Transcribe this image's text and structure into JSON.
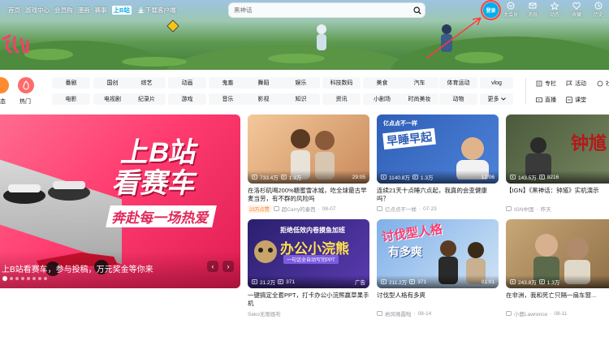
{
  "header": {
    "nav": [
      "首页",
      "游戏中心",
      "会员购",
      "漫画",
      "赛事"
    ],
    "tv": "上B站",
    "download": "下载客户端",
    "search_placeholder": "黑神话",
    "login": "登录",
    "right_icons": [
      {
        "icon": "vip-icon",
        "label": "大会员"
      },
      {
        "icon": "message-icon",
        "label": "消息"
      },
      {
        "icon": "dynamic-icon",
        "label": "动态"
      },
      {
        "icon": "favorite-icon",
        "label": "收藏"
      },
      {
        "icon": "history-icon",
        "label": "历史"
      }
    ]
  },
  "categories": {
    "big": [
      {
        "icon": "trending-icon",
        "label": "热门"
      },
      {
        "icon": "dynamic-icon",
        "label": "态"
      }
    ],
    "row1": [
      "番剧",
      "国创",
      "综艺",
      "动画",
      "鬼畜",
      "舞蹈",
      "娱乐",
      "科技数码",
      "美食",
      "汽车",
      "体育运动",
      "vlog"
    ],
    "row2": [
      "电影",
      "电视剧",
      "纪录片",
      "游戏",
      "音乐",
      "影视",
      "知识",
      "资讯",
      "小剧场",
      "时尚美妆",
      "动物",
      "更多"
    ],
    "links": [
      {
        "icon": "column-icon",
        "label": "专栏"
      },
      {
        "icon": "activity-icon",
        "label": "活动"
      },
      {
        "icon": "live-icon",
        "label": "直播"
      },
      {
        "icon": "course-icon",
        "label": "课堂"
      },
      {
        "icon": "community-icon",
        "label": "社"
      }
    ]
  },
  "hero": {
    "line1": "上B站",
    "line2": "看赛车",
    "slogan": "奔赴每一场热爱",
    "caption": "上B站看赛车，参与投稿，万元奖金等你来",
    "prev": "‹",
    "next": "›"
  },
  "videos": [
    {
      "plays": "733.4万",
      "danmaku": "1.3万",
      "duration": "29:05",
      "title": "在洛杉矶喝200%糖蜜雪冰城，吃全球最古早麦当劳，有不群的风险吗",
      "tag": "23万点赞",
      "up": "超Carry的秦西",
      "date": "08-07",
      "thumb": "#d9a67a"
    },
    {
      "plays": "1140.8万",
      "danmaku": "1.3万",
      "duration": "12:06",
      "title": "连续21天十点睡六点起，我真的会变健康吗？",
      "tag": "",
      "up": "亿点点不一样",
      "date": "07-23",
      "thumb": "#3a6fc4",
      "overlay_brand": "亿点点不一样",
      "overlay_title": "早睡早起"
    },
    {
      "plays": "143.5万",
      "danmaku": "8216",
      "duration": "",
      "title": "【IGN】《黑神话：钟馗》实机演示",
      "tag": "",
      "up": "IGN中国",
      "date": "昨天",
      "thumb": "#5a6a4a",
      "overlay_title": "钟馗"
    },
    {
      "plays": "21.2万",
      "danmaku": "371",
      "duration": "",
      "title": "一键搞定全套PPT，打卡办公小浣熊赢草果手机",
      "tag": "",
      "up": "Seko无限画布",
      "date": "",
      "thumb": "#3b2a8a",
      "ad": "广告",
      "overlay_brand": "拒绝低效内卷摸鱼加班",
      "overlay_title": "办公小浣熊",
      "overlay_sub": "一句话全自动写完PPT"
    },
    {
      "plays": "211.2万",
      "danmaku": "371",
      "duration": "01:01",
      "title": "讨伐型人格有多爽",
      "tag": "",
      "up": "岩风晚霞啦",
      "date": "08-14",
      "thumb": "#6e9bd6",
      "overlay_title": "讨伐型人格",
      "overlay_sub": "有多爽"
    },
    {
      "plays": "243.8万",
      "danmaku": "1.3万",
      "duration": "",
      "title": "在非洲，我和死亡只隔一扇车窗...",
      "tag": "",
      "up": "小鹿Lawrence",
      "date": "08-11",
      "thumb": "#b08a5a"
    }
  ]
}
